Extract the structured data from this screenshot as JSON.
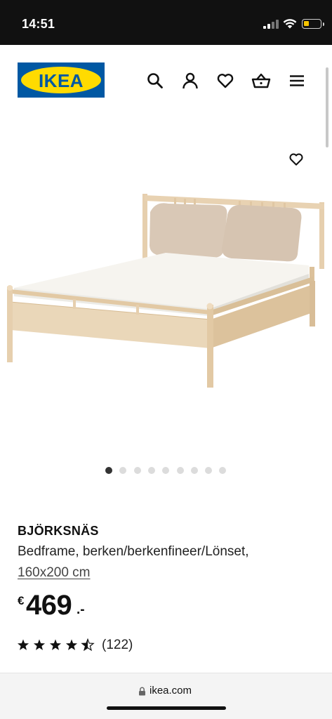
{
  "status_bar": {
    "time": "14:51",
    "battery_color": "#f5c400"
  },
  "header": {
    "logo_text": "IKEA",
    "brand_blue": "#0058a3",
    "brand_yellow": "#ffdb00",
    "icons": [
      "search-icon",
      "account-icon",
      "wishlist-heart-icon",
      "shopping-basket-icon",
      "menu-icon"
    ]
  },
  "product": {
    "image_icon": "bedframe-image",
    "gallery": {
      "count": 9,
      "active": 1
    },
    "name": "BJÖRKSNÄS",
    "description": "Bedframe, berken/berkenfineer/Lönset,",
    "size": "160x200 cm",
    "price": {
      "currency": "€",
      "integer": "469",
      "decimals": ".-"
    },
    "rating": {
      "value": 4.5,
      "max": 5,
      "count_label": "(122)"
    }
  },
  "browser": {
    "url": "ikea.com"
  }
}
